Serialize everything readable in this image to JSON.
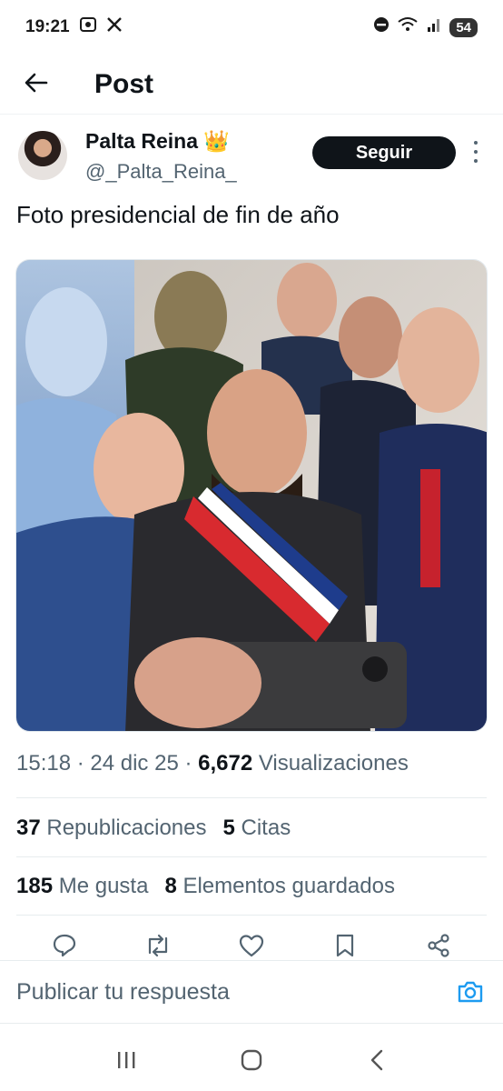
{
  "status_bar": {
    "time": "19:21",
    "battery": "54"
  },
  "header": {
    "title": "Post"
  },
  "author": {
    "name": "Palta Reina",
    "crown": "👑",
    "handle": "@_Palta_Reina_"
  },
  "follow_label": "Seguir",
  "tweet_text": "Foto presidencial de fin de año",
  "meta": {
    "time": "15:18",
    "date": "24 dic 25",
    "views_count": "6,672",
    "views_label": "Visualizaciones"
  },
  "stats": {
    "reposts_count": "37",
    "reposts_label": "Republicaciones",
    "quotes_count": "5",
    "quotes_label": "Citas",
    "likes_count": "185",
    "likes_label": "Me gusta",
    "bookmarks_count": "8",
    "bookmarks_label": "Elementos guardados"
  },
  "actions": [
    "reply-icon",
    "repost-icon",
    "like-icon",
    "bookmark-icon",
    "share-icon"
  ],
  "reply": {
    "placeholder": "Publicar tu respuesta"
  },
  "colors": {
    "accent": "#1d9bf0",
    "text": "#0f1419",
    "secondary": "#536471",
    "follow_bg": "#0f1419"
  }
}
